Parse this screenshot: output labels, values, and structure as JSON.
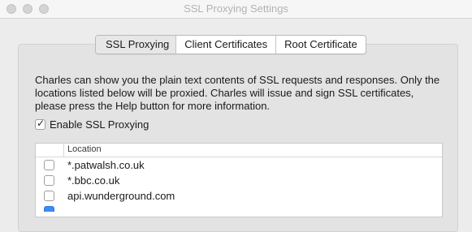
{
  "window": {
    "title": "SSL Proxying Settings"
  },
  "tabs": [
    {
      "label": "SSL Proxying"
    },
    {
      "label": "Client Certificates"
    },
    {
      "label": "Root Certificate"
    }
  ],
  "description": "Charles can show you the plain text contents of SSL requests and responses. Only the locations listed below will be proxied. Charles will issue and sign SSL certificates, please press the Help button for more information.",
  "enable_ssl": {
    "label": "Enable SSL Proxying",
    "checked": true
  },
  "locations_table": {
    "header": "Location",
    "rows": [
      {
        "location": "*.patwalsh.co.uk",
        "enabled": false
      },
      {
        "location": "*.bbc.co.uk",
        "enabled": false
      },
      {
        "location": "api.wunderground.com",
        "enabled": false
      }
    ]
  },
  "colors": {
    "accent": "#3b8cf4"
  }
}
